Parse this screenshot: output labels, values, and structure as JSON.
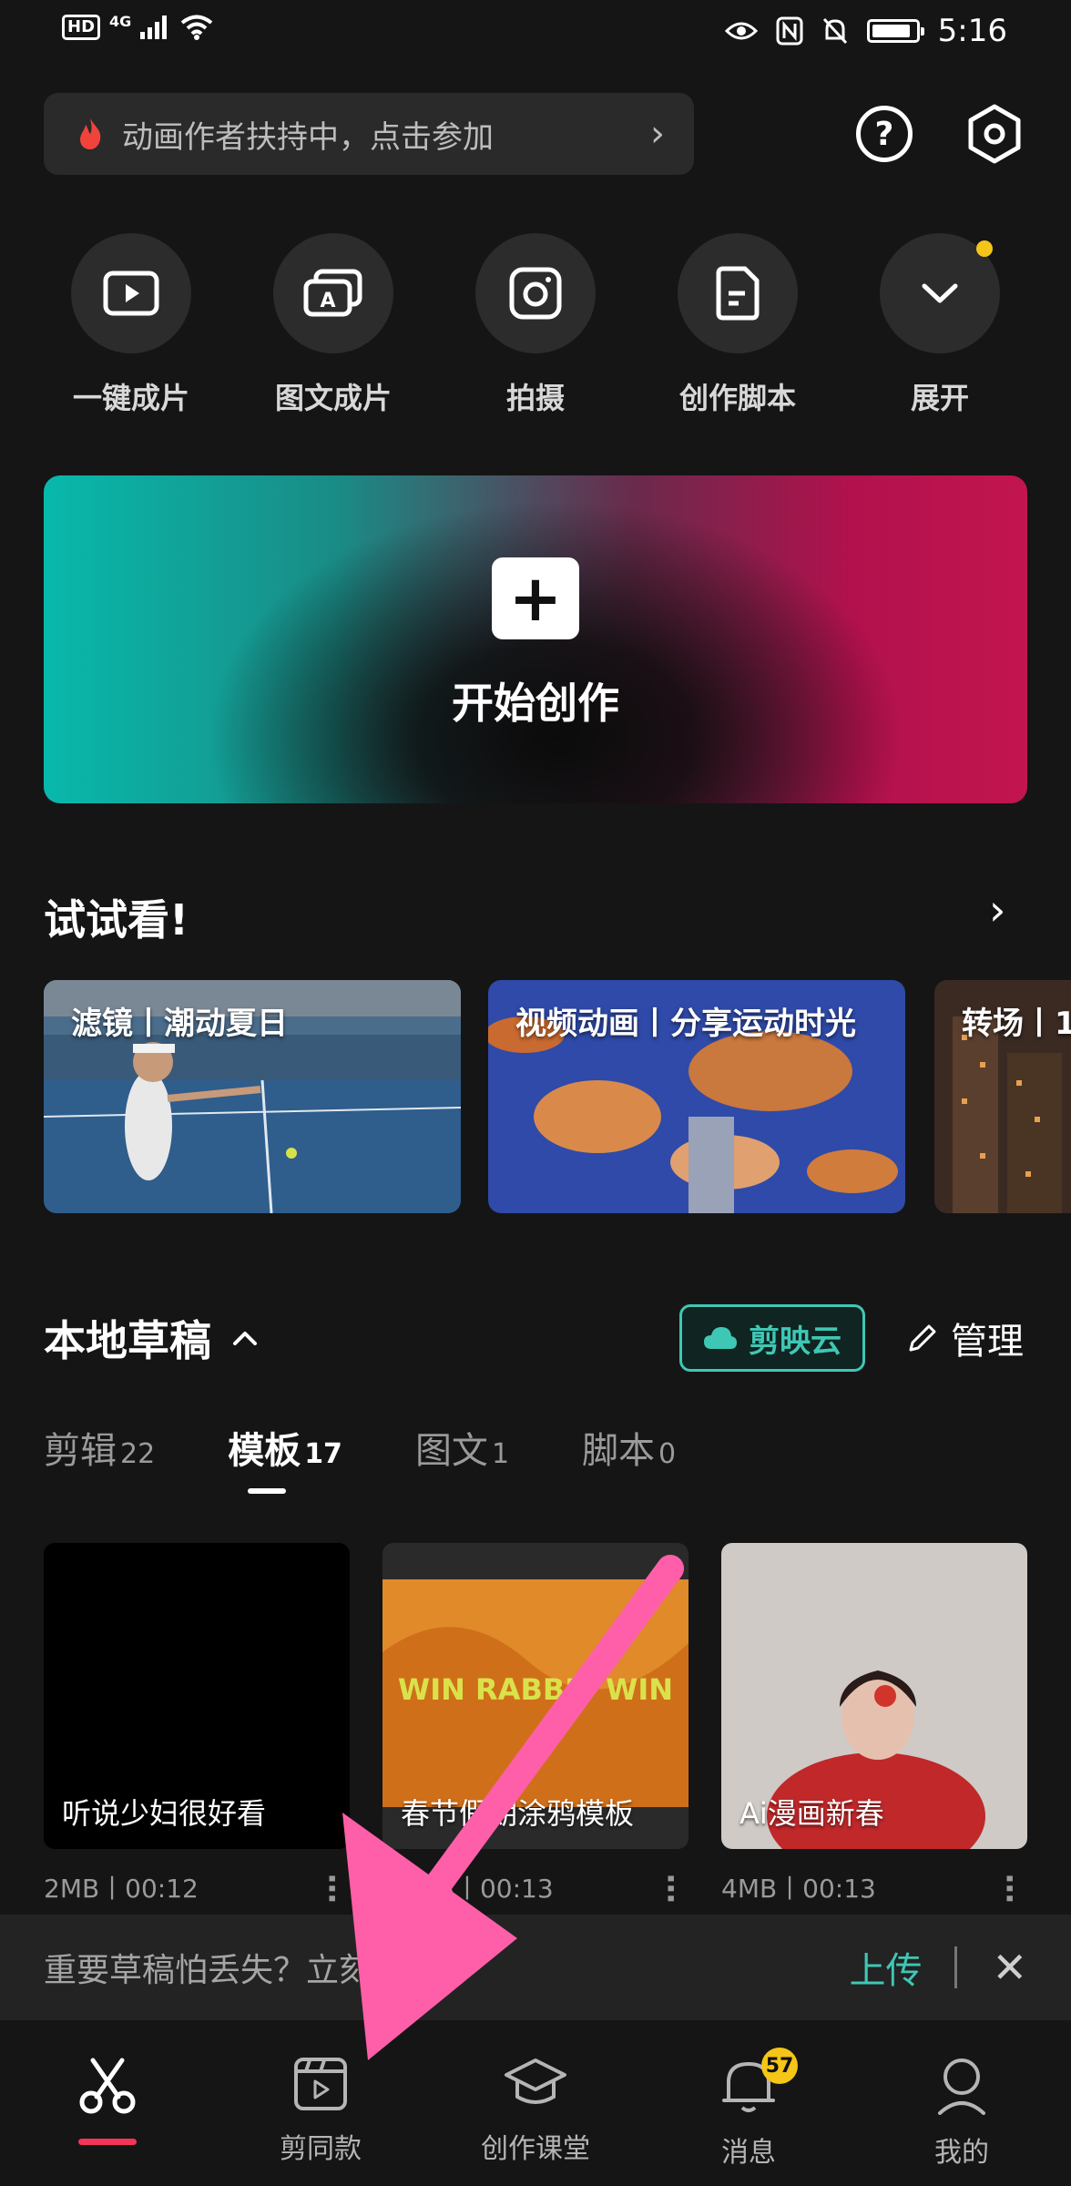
{
  "status_bar": {
    "hd": "HD",
    "network": "4G",
    "time": "5:16"
  },
  "banner": {
    "text": "动画作者扶持中，点击参加"
  },
  "quick_actions": [
    {
      "label": "一键成片",
      "icon": "play-video-icon"
    },
    {
      "label": "图文成片",
      "icon": "text-image-icon"
    },
    {
      "label": "拍摄",
      "icon": "camera-icon"
    },
    {
      "label": "创作脚本",
      "icon": "script-doc-icon"
    },
    {
      "label": "展开",
      "icon": "chevron-down-icon"
    }
  ],
  "hero": {
    "label": "开始创作",
    "colors": {
      "left": "#08b9ab",
      "right": "#c3154f"
    }
  },
  "try_it": {
    "title": "试试看!",
    "cards": [
      {
        "label": "滤镜丨潮动夏日"
      },
      {
        "label": "视频动画丨分享运动时光"
      },
      {
        "label": "转场丨1"
      }
    ]
  },
  "drafts": {
    "title": "本地草稿",
    "cloud_label": "剪映云",
    "manage_label": "管理",
    "tabs": [
      {
        "label": "剪辑",
        "count": "22"
      },
      {
        "label": "模板",
        "count": "17"
      },
      {
        "label": "图文",
        "count": "1"
      },
      {
        "label": "脚本",
        "count": "0"
      }
    ],
    "active_tab": "模板",
    "items": [
      {
        "title": "听说少妇很好看",
        "meta": "2MB丨00:12"
      },
      {
        "title": "春节假期涂鸦模板",
        "meta": "15MB丨00:13"
      },
      {
        "title": "Ai漫画新春",
        "meta": "4MB丨00:13"
      }
    ]
  },
  "tip": {
    "text": "重要草稿怕丢失？立刻",
    "upload_label": "上传"
  },
  "nav": {
    "items": [
      {
        "label": "",
        "icon": "scissors-icon"
      },
      {
        "label": "剪同款",
        "icon": "template-clapper-icon"
      },
      {
        "label": "创作课堂",
        "icon": "graduation-cap-icon"
      },
      {
        "label": "消息",
        "icon": "bell-icon"
      },
      {
        "label": "我的",
        "icon": "profile-icon"
      }
    ],
    "message_badge": "57",
    "accent": "#f33559"
  },
  "colors": {
    "background": "#151515",
    "cloud_accent": "#3fc7b5",
    "arrow": "#ff5fa8"
  }
}
